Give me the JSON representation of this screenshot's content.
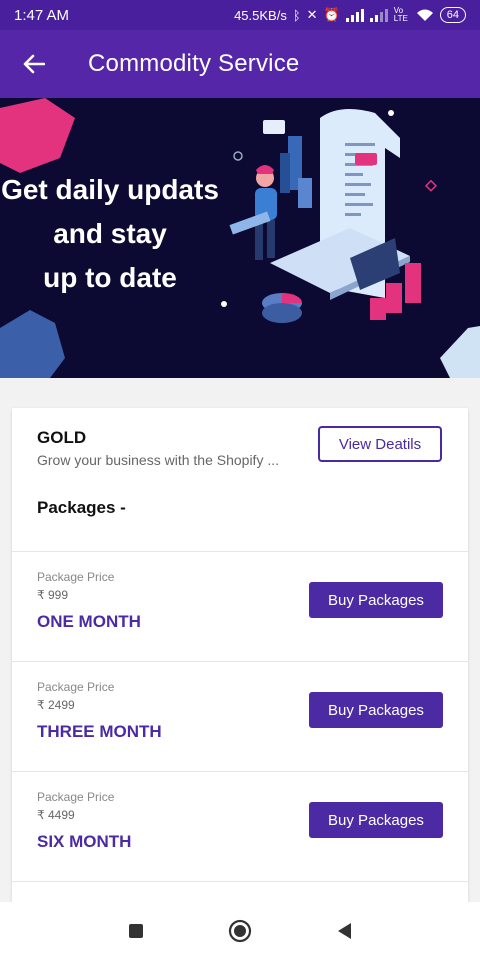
{
  "status_bar": {
    "time": "1:47 AM",
    "network_speed": "45.5KB/s",
    "lte": "Vo LTE",
    "battery": "64"
  },
  "app_bar": {
    "title": "Commodity Service",
    "back_icon": "arrow-left-icon"
  },
  "banner": {
    "lines": [
      "Get daily updats",
      "and stay",
      "up to date"
    ]
  },
  "service": {
    "title": "GOLD",
    "description": "Grow your business with the Shopify ...",
    "view_button": "View Deatils",
    "packages_heading": "Packages  -"
  },
  "packages": [
    {
      "label": "Package Price",
      "price": "₹ 999",
      "duration": "ONE MONTH",
      "button": "Buy Packages"
    },
    {
      "label": "Package Price",
      "price": "₹ 2499",
      "duration": "THREE MONTH",
      "button": "Buy Packages"
    },
    {
      "label": "Package Price",
      "price": "₹ 4499",
      "duration": "SIX MONTH",
      "button": "Buy Packages"
    }
  ],
  "nav": {
    "recents_icon": "square-icon",
    "home_icon": "circle-icon",
    "back_icon": "triangle-back-icon"
  },
  "colors": {
    "primary": "#5527a8",
    "status_bar": "#4a1f9e",
    "accent_text": "#4b2aa3",
    "banner_bg": "#0c0a33"
  }
}
